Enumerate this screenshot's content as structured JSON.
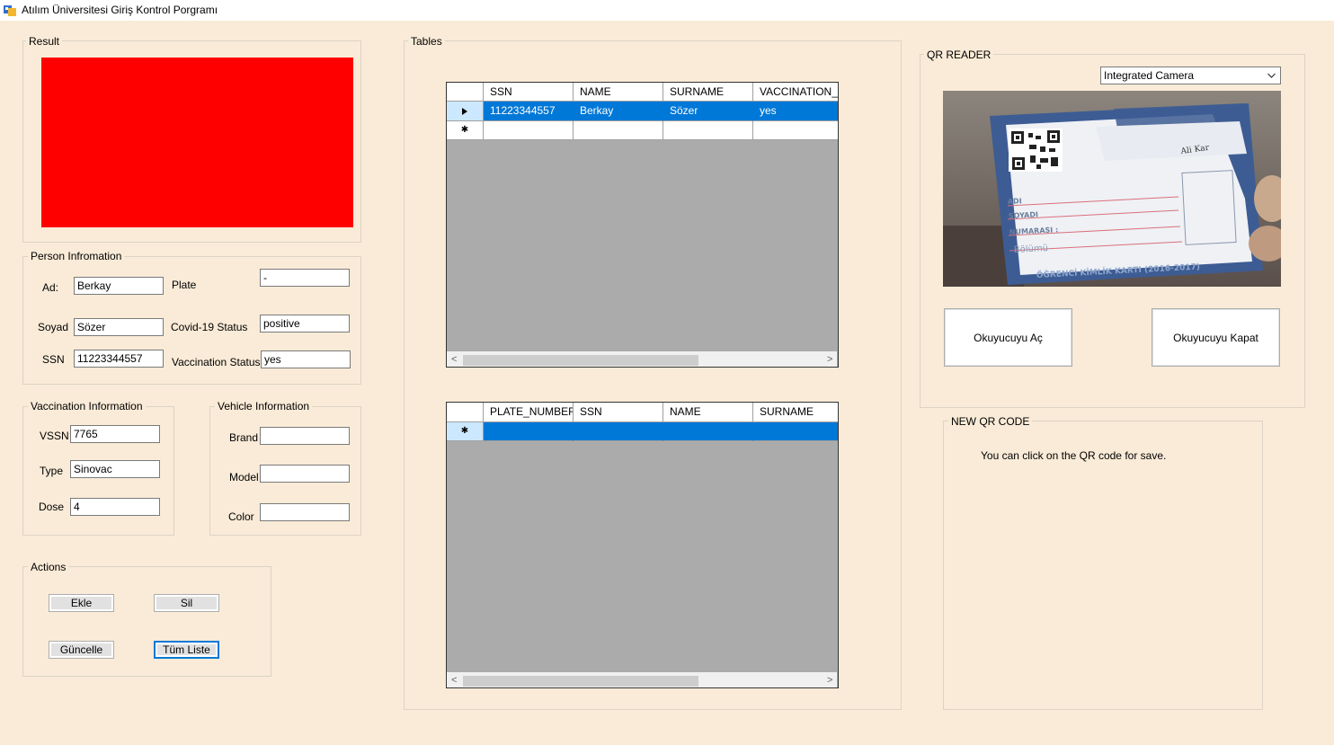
{
  "window": {
    "title": "Atılım Üniversitesi Giriş Kontrol Porgramı"
  },
  "result": {
    "label": "Result",
    "color": "#FF0000"
  },
  "person": {
    "label": "Person Infromation",
    "ad_label": "Ad:",
    "ad_value": "Berkay",
    "soyad_label": "Soyad",
    "soyad_value": "Sözer",
    "ssn_label": "SSN",
    "ssn_value": "11223344557",
    "plate_label": "Plate",
    "plate_value": "-",
    "covid_label": "Covid-19 Status",
    "covid_value": "positive",
    "vacc_label": "Vaccination Status",
    "vacc_value": "yes"
  },
  "vaccination": {
    "label": "Vaccination Information",
    "vssn_label": "VSSN",
    "vssn_value": "7765",
    "type_label": "Type",
    "type_value": "Sinovac",
    "dose_label": "Dose",
    "dose_value": "4"
  },
  "vehicle": {
    "label": "Vehicle Information",
    "brand_label": "Brand",
    "brand_value": "",
    "model_label": "Model",
    "model_value": "",
    "color_label": "Color",
    "color_value": ""
  },
  "actions": {
    "label": "Actions",
    "add": "Ekle",
    "delete": "Sil",
    "update": "Güncelle",
    "list_all": "Tüm Liste"
  },
  "tables": {
    "label": "Tables",
    "persons": {
      "columns": [
        "SSN",
        "NAME",
        "SURNAME",
        "VACCINATION_ST"
      ],
      "rows": [
        [
          "11223344557",
          "Berkay",
          "Sözer",
          "yes"
        ]
      ]
    },
    "vehicles": {
      "columns": [
        "PLATE_NUMBER",
        "SSN",
        "NAME",
        "SURNAME"
      ]
    }
  },
  "qr_reader": {
    "label": "QR READER",
    "camera": "Integrated Camera",
    "open_button": "Okuyucuyu Aç",
    "close_button": "Okuyucuyu Kapat",
    "card": {
      "handwriting": "Ali Kar",
      "field1": "ADI",
      "field2": "SOYADI",
      "field3": "NUMARASI :",
      "field4": "Bölümü",
      "footer": "ÖĞRENCİ KİMLİK KARTI (2016-2017)"
    }
  },
  "new_qr": {
    "label": "NEW QR CODE",
    "hint": "You can click on the QR code for save."
  },
  "icons": {
    "app": "app-icon",
    "current_row": "row-pointer-icon",
    "new_row": "new-row-icon",
    "dropdown": "chevron-down-icon"
  }
}
